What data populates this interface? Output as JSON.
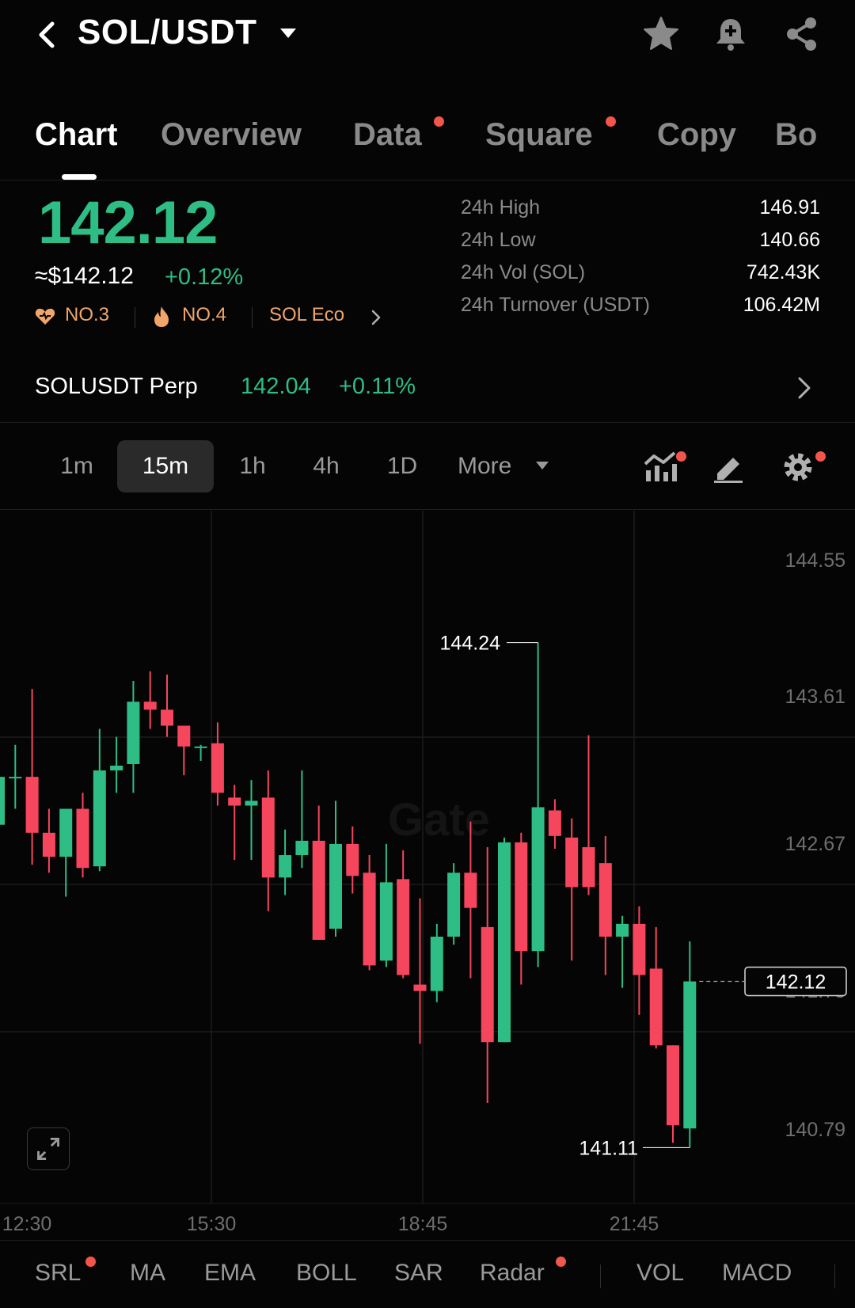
{
  "header": {
    "pair": "SOL/USDT",
    "icons": [
      "back-icon",
      "caret-down-icon",
      "star-icon",
      "bell-plus-icon",
      "share-icon"
    ]
  },
  "tabs": [
    {
      "label": "Chart",
      "active": true,
      "dot": false
    },
    {
      "label": "Overview",
      "active": false,
      "dot": false
    },
    {
      "label": "Data",
      "active": false,
      "dot": true
    },
    {
      "label": "Square",
      "active": false,
      "dot": true
    },
    {
      "label": "Copy",
      "active": false,
      "dot": false
    },
    {
      "label": "Bo",
      "active": false,
      "dot": false
    }
  ],
  "ticker": {
    "last_price": "142.12",
    "usd_price": "≈$142.12",
    "change_pct": "+0.12%",
    "ranks": [
      {
        "icon": "heart-icon",
        "label": "NO.3"
      },
      {
        "icon": "fire-icon",
        "label": "NO.4"
      },
      {
        "icon": "chevron-right-icon",
        "label": "SOL Eco"
      }
    ],
    "stats": [
      {
        "label": "24h High",
        "value": "146.91"
      },
      {
        "label": "24h Low",
        "value": "140.66"
      },
      {
        "label": "24h Vol (SOL)",
        "value": "742.43K"
      },
      {
        "label": "24h Turnover (USDT)",
        "value": "106.42M"
      }
    ]
  },
  "perp": {
    "name": "SOLUSDT Perp",
    "price": "142.04",
    "change": "+0.11%"
  },
  "intervals": {
    "items": [
      "1m",
      "15m",
      "1h",
      "4h",
      "1D"
    ],
    "active": "15m",
    "more_label": "More",
    "tools": [
      "indicator-icon",
      "draw-icon",
      "settings-icon"
    ]
  },
  "colors": {
    "up": "#2ebd85",
    "down": "#f6465d",
    "accent_dot": "#f2554a",
    "rank": "#f0a56a"
  },
  "chart_data": {
    "type": "candlestick",
    "y_ticks": [
      "144.55",
      "143.61",
      "142.67",
      "141.73",
      "140.79"
    ],
    "x_ticks": [
      "12:30",
      "15:30",
      "18:45",
      "21:45"
    ],
    "ylim": [
      140.79,
      144.55
    ],
    "watermark": "Gate",
    "high_marker": "144.24",
    "low_marker": "141.11",
    "last_price_label": "142.12",
    "candles": [
      {
        "o": 143.1,
        "h": 143.45,
        "l": 142.8,
        "c": 143.4
      },
      {
        "o": 143.4,
        "h": 143.6,
        "l": 143.2,
        "c": 143.4
      },
      {
        "o": 143.4,
        "h": 143.95,
        "l": 142.85,
        "c": 143.05
      },
      {
        "o": 143.05,
        "h": 143.2,
        "l": 142.8,
        "c": 142.9
      },
      {
        "o": 142.9,
        "h": 143.2,
        "l": 142.65,
        "c": 143.2
      },
      {
        "o": 143.2,
        "h": 143.3,
        "l": 142.77,
        "c": 142.83
      },
      {
        "o": 142.84,
        "h": 143.7,
        "l": 142.81,
        "c": 143.44
      },
      {
        "o": 143.44,
        "h": 143.65,
        "l": 143.3,
        "c": 143.47
      },
      {
        "o": 143.48,
        "h": 144.0,
        "l": 143.3,
        "c": 143.87
      },
      {
        "o": 143.87,
        "h": 144.06,
        "l": 143.7,
        "c": 143.82
      },
      {
        "o": 143.82,
        "h": 144.04,
        "l": 143.65,
        "c": 143.72
      },
      {
        "o": 143.72,
        "h": 143.72,
        "l": 143.41,
        "c": 143.59
      },
      {
        "o": 143.59,
        "h": 143.6,
        "l": 143.5,
        "c": 143.59
      },
      {
        "o": 143.61,
        "h": 143.74,
        "l": 143.22,
        "c": 143.3
      },
      {
        "o": 143.27,
        "h": 143.35,
        "l": 142.88,
        "c": 143.22
      },
      {
        "o": 143.22,
        "h": 143.38,
        "l": 142.88,
        "c": 143.25
      },
      {
        "o": 143.27,
        "h": 143.44,
        "l": 142.56,
        "c": 142.77
      },
      {
        "o": 142.77,
        "h": 143.07,
        "l": 142.66,
        "c": 142.91
      },
      {
        "o": 142.91,
        "h": 143.44,
        "l": 142.83,
        "c": 143.0
      },
      {
        "o": 143.0,
        "h": 143.22,
        "l": 142.4,
        "c": 142.38
      },
      {
        "o": 142.45,
        "h": 143.25,
        "l": 142.4,
        "c": 142.98
      },
      {
        "o": 142.98,
        "h": 143.09,
        "l": 142.67,
        "c": 142.78
      },
      {
        "o": 142.8,
        "h": 142.91,
        "l": 142.19,
        "c": 142.22
      },
      {
        "o": 142.25,
        "h": 142.98,
        "l": 142.21,
        "c": 142.74
      },
      {
        "o": 142.76,
        "h": 142.94,
        "l": 142.14,
        "c": 142.16
      },
      {
        "o": 142.1,
        "h": 142.64,
        "l": 141.73,
        "c": 142.06
      },
      {
        "o": 142.06,
        "h": 142.48,
        "l": 141.99,
        "c": 142.4
      },
      {
        "o": 142.4,
        "h": 142.86,
        "l": 142.35,
        "c": 142.8
      },
      {
        "o": 142.8,
        "h": 143.12,
        "l": 142.14,
        "c": 142.58
      },
      {
        "o": 142.46,
        "h": 142.96,
        "l": 141.36,
        "c": 141.74
      },
      {
        "o": 141.74,
        "h": 143.02,
        "l": 141.74,
        "c": 142.99
      },
      {
        "o": 142.99,
        "h": 143.05,
        "l": 142.1,
        "c": 142.31
      },
      {
        "o": 142.31,
        "h": 144.24,
        "l": 142.21,
        "c": 143.21
      },
      {
        "o": 143.19,
        "h": 143.26,
        "l": 142.95,
        "c": 143.03
      },
      {
        "o": 143.02,
        "h": 143.14,
        "l": 142.25,
        "c": 142.71
      },
      {
        "o": 142.96,
        "h": 143.66,
        "l": 142.66,
        "c": 142.71
      },
      {
        "o": 142.86,
        "h": 143.03,
        "l": 142.16,
        "c": 142.4
      },
      {
        "o": 142.4,
        "h": 142.53,
        "l": 142.08,
        "c": 142.48
      },
      {
        "o": 142.48,
        "h": 142.59,
        "l": 141.91,
        "c": 142.16
      },
      {
        "o": 142.2,
        "h": 142.46,
        "l": 141.7,
        "c": 141.72
      },
      {
        "o": 141.72,
        "h": 141.72,
        "l": 141.11,
        "c": 141.22
      },
      {
        "o": 141.2,
        "h": 142.37,
        "l": 141.08,
        "c": 142.12
      }
    ]
  },
  "indicators": [
    {
      "label": "SRL",
      "dot": true
    },
    {
      "label": "MA",
      "dot": false
    },
    {
      "label": "EMA",
      "dot": false
    },
    {
      "label": "BOLL",
      "dot": false
    },
    {
      "label": "SAR",
      "dot": false
    },
    {
      "label": "Radar",
      "dot": true
    },
    {
      "label": "VOL",
      "dot": false
    },
    {
      "label": "MACD",
      "dot": false
    }
  ]
}
